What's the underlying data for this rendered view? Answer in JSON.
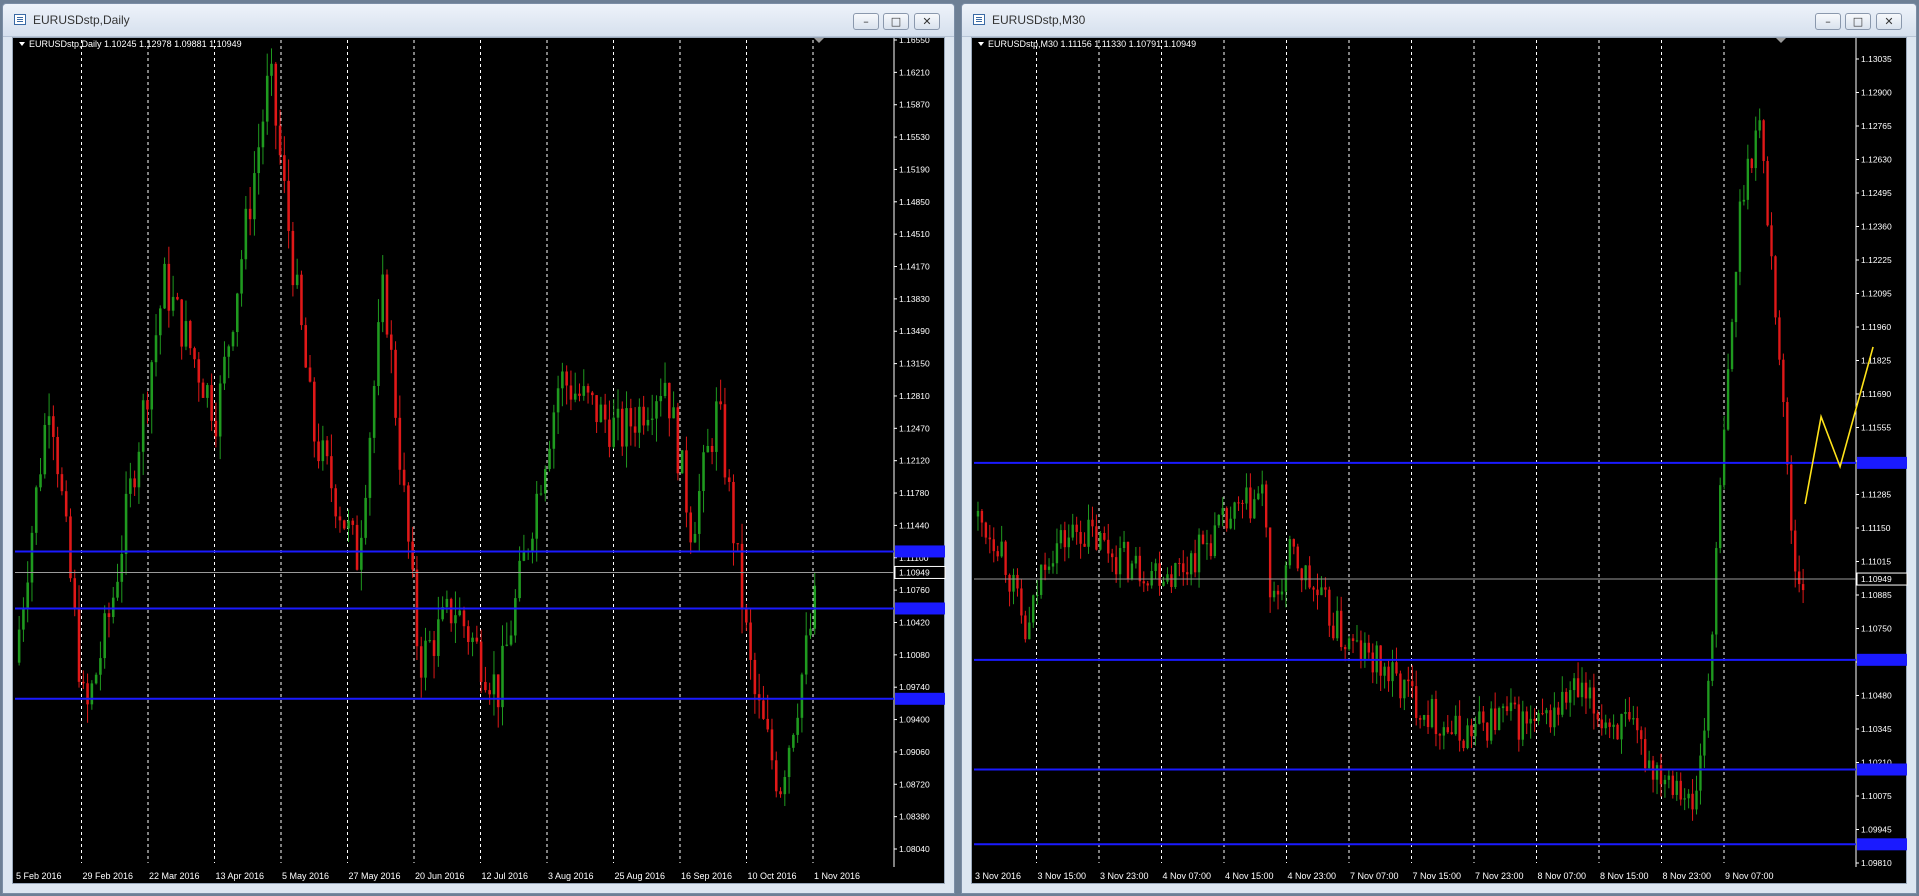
{
  "windows": [
    {
      "title": "EURUSDstp,Daily",
      "chart_data": {
        "type": "candlestick",
        "symbol_line": "EURUSDstp,Daily  1.10245 1.12978 1.09881 1.10949",
        "last_price_label": "1.10949",
        "y_ticks": [
          "1.16550",
          "1.16210",
          "1.15870",
          "1.15530",
          "1.15190",
          "1.14850",
          "1.14510",
          "1.14170",
          "1.13830",
          "1.13490",
          "1.13150",
          "1.12810",
          "1.12470",
          "1.12120",
          "1.11780",
          "1.11440",
          "1.11100",
          "1.10760",
          "1.10420",
          "1.10080",
          "1.09740",
          "1.09400",
          "1.09060",
          "1.08720",
          "1.08380",
          "1.08040"
        ],
        "x_ticks": [
          "5 Feb 2016",
          "29 Feb 2016",
          "22 Mar 2016",
          "13 Apr 2016",
          "5 May 2016",
          "27 May 2016",
          "20 Jun 2016",
          "12 Jul 2016",
          "3 Aug 2016",
          "25 Aug 2016",
          "16 Sep 2016",
          "10 Oct 2016",
          "1 Nov 2016"
        ],
        "ylim": [
          1.0804,
          1.1655
        ],
        "horizontal_lines": [
          1.1117,
          1.1057,
          1.0962
        ],
        "last_price": 1.10949,
        "series_path": [
          [
            0,
            1.1
          ],
          [
            0.04,
            1.129
          ],
          [
            0.08,
            1.094
          ],
          [
            0.11,
            1.106
          ],
          [
            0.17,
            1.14
          ],
          [
            0.23,
            1.126
          ],
          [
            0.29,
            1.162
          ],
          [
            0.34,
            1.124
          ],
          [
            0.39,
            1.111
          ],
          [
            0.42,
            1.14
          ],
          [
            0.46,
            1.1
          ],
          [
            0.5,
            1.106
          ],
          [
            0.55,
            1.097
          ],
          [
            0.62,
            1.13
          ],
          [
            0.69,
            1.124
          ],
          [
            0.74,
            1.13
          ],
          [
            0.77,
            1.114
          ],
          [
            0.8,
            1.127
          ],
          [
            0.84,
            1.097
          ],
          [
            0.87,
            1.087
          ],
          [
            0.89,
            1.096
          ],
          [
            0.91,
            1.106
          ]
        ]
      }
    },
    {
      "title": "EURUSDstp,M30",
      "chart_data": {
        "type": "candlestick",
        "symbol_line": "EURUSDstp,M30  1.11156 1.11330 1.10791 1.10949",
        "last_price_label": "1.10949",
        "y_ticks": [
          "1.13035",
          "1.12900",
          "1.12765",
          "1.12630",
          "1.12495",
          "1.12360",
          "1.12225",
          "1.12095",
          "1.11960",
          "1.11825",
          "1.11690",
          "1.11555",
          "1.11420",
          "1.11285",
          "1.11150",
          "1.11015",
          "1.10885",
          "1.10750",
          "1.10615",
          "1.10480",
          "1.10345",
          "1.10210",
          "1.10075",
          "1.09945",
          "1.09810"
        ],
        "x_ticks": [
          "3 Nov 2016",
          "3 Nov 15:00",
          "3 Nov 23:00",
          "4 Nov 07:00",
          "4 Nov 15:00",
          "4 Nov 23:00",
          "7 Nov 07:00",
          "7 Nov 15:00",
          "7 Nov 23:00",
          "8 Nov 07:00",
          "8 Nov 15:00",
          "8 Nov 23:00",
          "9 Nov 07:00"
        ],
        "ylim": [
          1.0981,
          1.13035
        ],
        "horizontal_lines": [
          1.11415,
          1.10625,
          1.10185,
          1.09885
        ],
        "last_price": 1.10949,
        "projection": [
          [
            1.1125,
            1.116
          ],
          [
            1.114,
            1.1188
          ]
        ],
        "series_path": [
          [
            0,
            1.112
          ],
          [
            0.03,
            1.111
          ],
          [
            0.06,
            1.107
          ],
          [
            0.08,
            1.1105
          ],
          [
            0.12,
            1.1115
          ],
          [
            0.18,
            1.11
          ],
          [
            0.23,
            1.1098
          ],
          [
            0.28,
            1.1115
          ],
          [
            0.33,
            1.113
          ],
          [
            0.335,
            1.108
          ],
          [
            0.36,
            1.1105
          ],
          [
            0.42,
            1.107
          ],
          [
            0.46,
            1.106
          ],
          [
            0.49,
            1.105
          ],
          [
            0.52,
            1.104
          ],
          [
            0.55,
            1.1032
          ],
          [
            0.6,
            1.104
          ],
          [
            0.64,
            1.1035
          ],
          [
            0.68,
            1.105
          ],
          [
            0.71,
            1.104
          ],
          [
            0.74,
            1.1035
          ],
          [
            0.77,
            1.102
          ],
          [
            0.8,
            1.1015
          ],
          [
            0.815,
            1.1
          ],
          [
            0.83,
            1.104
          ],
          [
            0.85,
            1.115
          ],
          [
            0.87,
            1.125
          ],
          [
            0.89,
            1.128
          ],
          [
            0.91,
            1.12
          ],
          [
            0.93,
            1.11
          ],
          [
            0.94,
            1.1095
          ]
        ]
      }
    }
  ]
}
